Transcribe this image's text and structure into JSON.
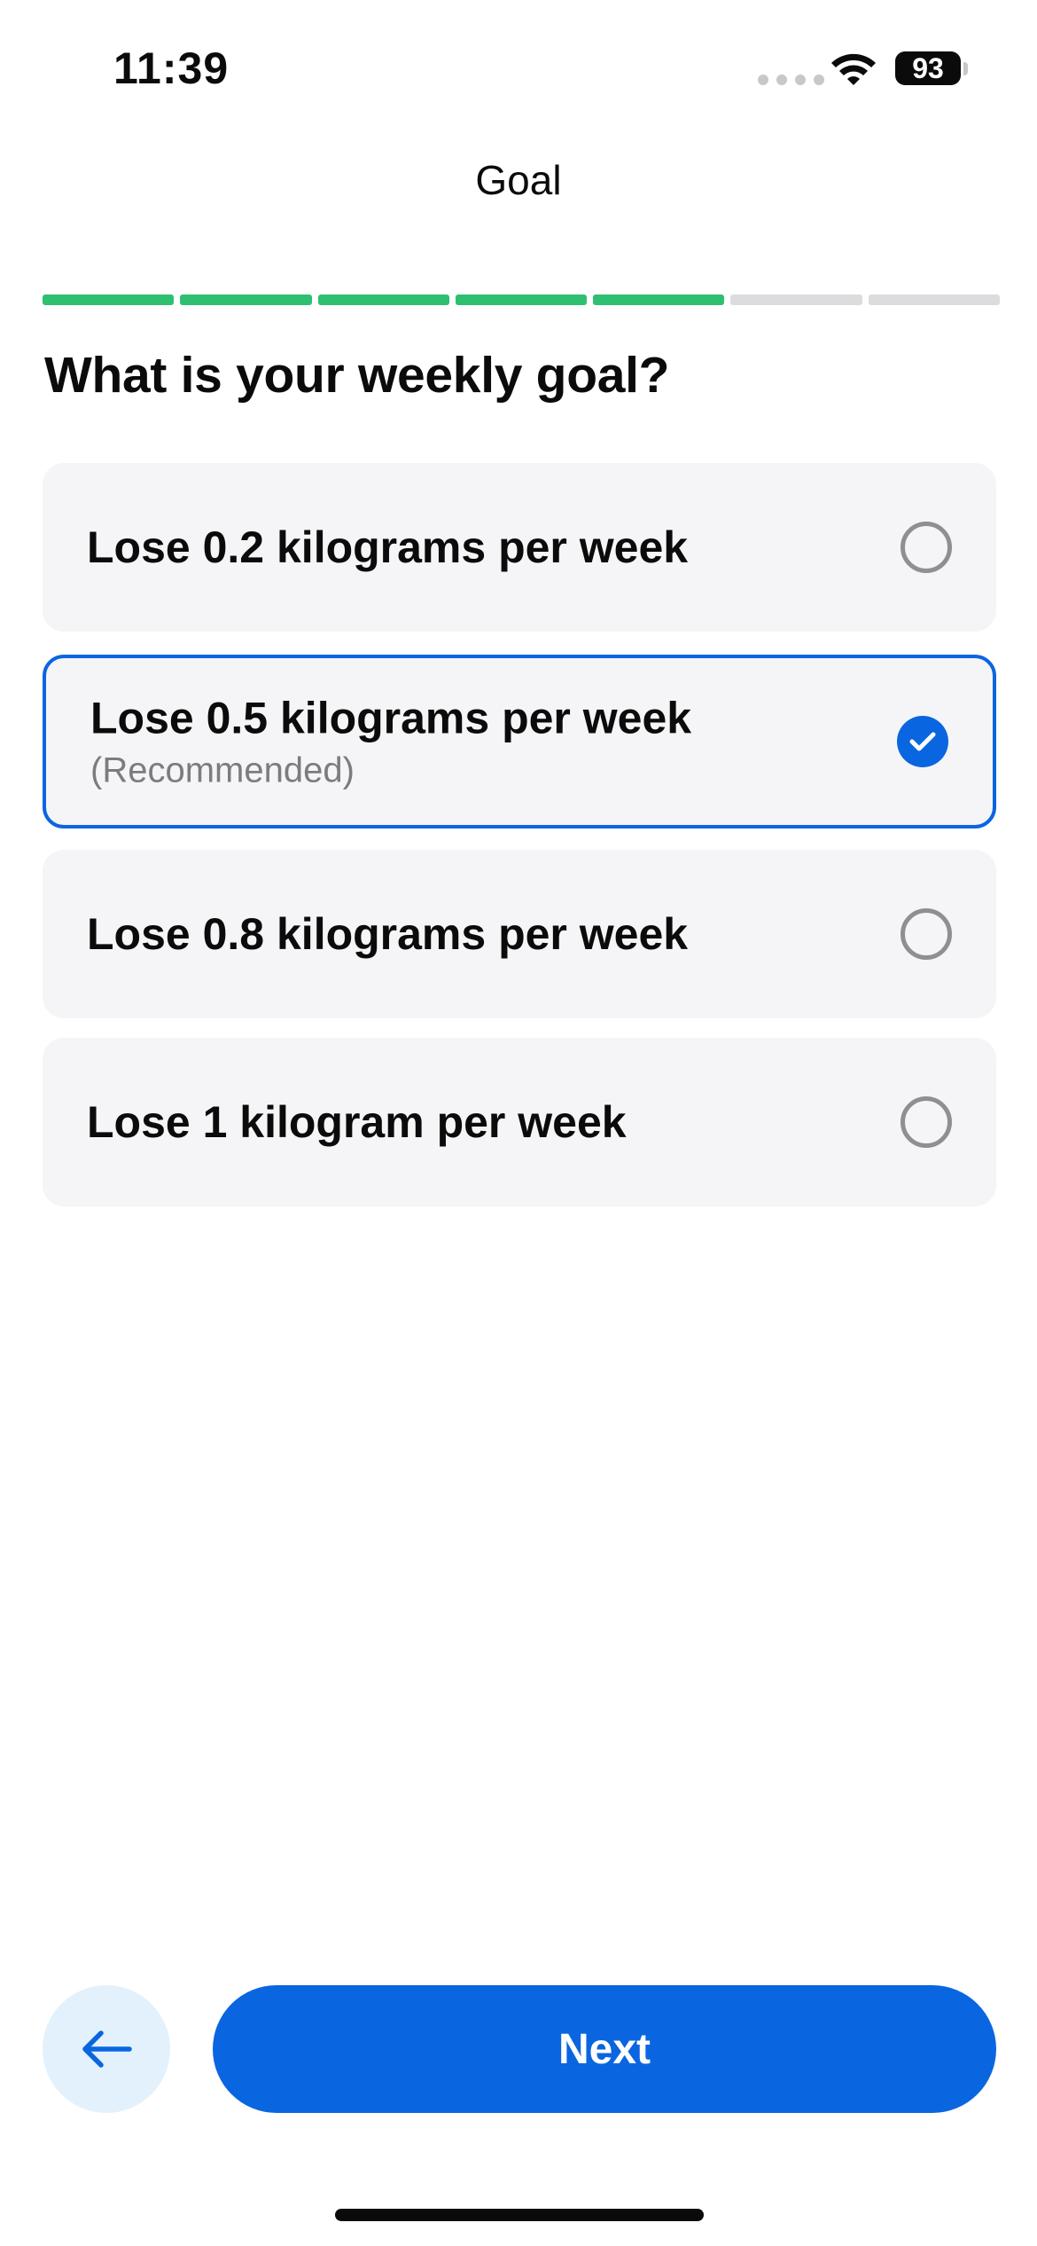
{
  "status_bar": {
    "time": "11:39",
    "battery": "93"
  },
  "header": {
    "title": "Goal"
  },
  "progress": {
    "completed_steps": 5,
    "total_steps": 7
  },
  "question": "What is your weekly goal?",
  "options": [
    {
      "label": "Lose 0.2 kilograms per week",
      "sub": "",
      "selected": false
    },
    {
      "label": "Lose 0.5 kilograms per week",
      "sub": "(Recommended)",
      "selected": true
    },
    {
      "label": "Lose 0.8 kilograms per week",
      "sub": "",
      "selected": false
    },
    {
      "label": "Lose 1 kilogram per week",
      "sub": "",
      "selected": false
    }
  ],
  "footer": {
    "next_label": "Next",
    "back_icon": "arrow-left-icon"
  },
  "colors": {
    "accent": "#0a66e0",
    "progress_done": "#2fbf71",
    "progress_todo": "#dcdcdf",
    "card_bg": "#f5f5f7",
    "back_bg": "#e3f1fc"
  }
}
